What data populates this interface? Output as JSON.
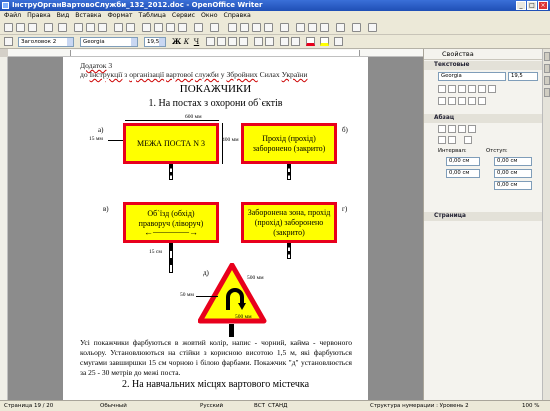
{
  "window": {
    "title": "ІнструОрганВартовоСлужби_132_2012.doc - OpenOffice Writer",
    "buttons": [
      "_",
      "□",
      "×"
    ]
  },
  "menu": [
    "Файл",
    "Правка",
    "Вид",
    "Вставка",
    "Формат",
    "Таблица",
    "Сервис",
    "Окно",
    "Справка"
  ],
  "formatting": {
    "paragraph_style": "Заголовок 2",
    "font_name": "Georgia",
    "font_size": "19,5",
    "bold": "Ж",
    "italic": "К",
    "underline": "Ч"
  },
  "document": {
    "header_line1_parts": [
      "Додаток",
      " 3"
    ],
    "header_line2_parts": [
      "до ",
      "Інструкції",
      " з ",
      "організації",
      " ",
      "вартової",
      " ",
      "служби",
      " у ",
      "Збройних",
      " Силах ",
      "України"
    ],
    "title": "ПОКАЖЧИКИ",
    "section1": "1. На постах з охорони об`єктів",
    "signs": {
      "a_label": "а)",
      "a_text": "МЕЖА ПОСТА N 3",
      "b_label": "б)",
      "b_text": "Прохід (прохід) заборонено (закрито)",
      "v_label": "в)",
      "v_text": "Об`їзд (обхід) праворуч (ліворуч)",
      "g_label": "г)",
      "g_text": "Заборонена зона, прохід (прохід) заборонено (закрито)",
      "d_label": "д)"
    },
    "dimensions": {
      "width_600": "600 мм",
      "height_400": "400 мм",
      "margin_15": "15 мм",
      "post_15cm": "15 см",
      "tri_500_side": "500 мм",
      "tri_50": "50 мм",
      "tri_500_base": "500 мм"
    },
    "paragraph": "Усі покажчики фарбуються в жовтий колір, напис - чорний, кайма - червоного кольору. Установлюються на стійки з корисною висотою 1,5 м, які фарбуються смугами завширшки 15 см чорною і білою фарбами. Покажчик \"д\" установлюється за 25 - 30 метрів до межі поста.",
    "section2": "2. На навчальних місцях вартового містечка"
  },
  "sidebar": {
    "title": "Свойства",
    "text_section": "Текстовые",
    "font_name": "Georgia",
    "font_size": "19,5",
    "paragraph_section": "Абзац",
    "interval_label": "Интервал:",
    "indent_label": "Отступ:",
    "spacing_values": [
      "0,00 см",
      "0,00 см",
      "0,00 см",
      "0,00 см",
      "0,00 см"
    ],
    "page_section": "Страница"
  },
  "status": {
    "page": "Страница 19 / 20",
    "style": "Обычный",
    "language": "Русский",
    "mode1": "ВСТ",
    "mode2": "СТАНД",
    "outline": "Структура нумерации : Уровень 2",
    "zoom": "100 %"
  },
  "colors": {
    "sign_fill": "#ffff00",
    "sign_border": "#e8001c",
    "titlebar": "#2a5fc8"
  }
}
